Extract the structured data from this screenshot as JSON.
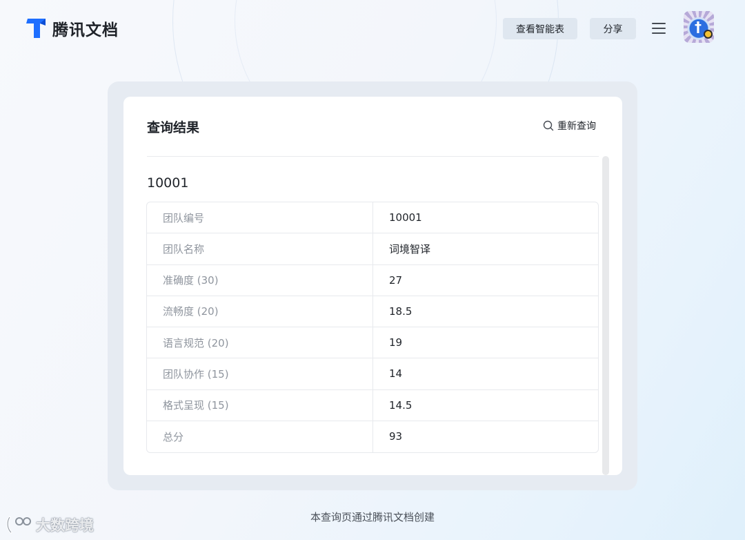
{
  "header": {
    "logo_text": "腾讯文档",
    "view_table_label": "查看智能表",
    "share_label": "分享"
  },
  "result": {
    "title": "查询结果",
    "requery_label": "重新查询",
    "record_id": "10001",
    "rows": [
      {
        "label": "团队编号",
        "value": "10001"
      },
      {
        "label": "团队名称",
        "value": "词境智译"
      },
      {
        "label": "准确度 (30)",
        "value": "27"
      },
      {
        "label": "流畅度 (20)",
        "value": "18.5"
      },
      {
        "label": "语言规范 (20)",
        "value": "19"
      },
      {
        "label": "团队协作 (15)",
        "value": "14"
      },
      {
        "label": "格式呈现 (15)",
        "value": "14.5"
      },
      {
        "label": "总分",
        "value": "93"
      }
    ]
  },
  "footer": {
    "text": "本查询页通过腾讯文档创建"
  },
  "watermark": {
    "text": "大数跨境"
  },
  "colors": {
    "brand_blue": "#1e6fff",
    "button_bg": "#dfe7f0",
    "label_gray": "#8f959e"
  }
}
